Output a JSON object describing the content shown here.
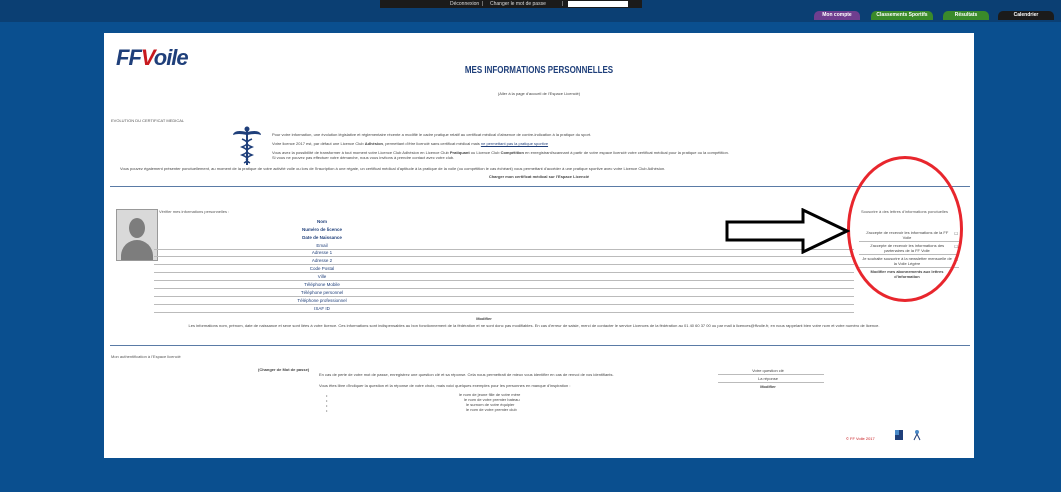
{
  "top_bar": {
    "links": [
      "Déconnexion",
      "|",
      "Changer le mot de passe",
      "|"
    ]
  },
  "tabs": [
    {
      "label": "Mon compte",
      "color": "#6f3e8f"
    },
    {
      "label": "Classements Sportifs",
      "color": "#3a8a2a"
    },
    {
      "label": "Résultats",
      "color": "#3a8a2a"
    },
    {
      "label": "Calendrier",
      "color": "#1b1b1b"
    }
  ],
  "logo": {
    "ff": "FF",
    "v": "V",
    "rest": "oile"
  },
  "page_title": "MES INFORMATIONS PERSONNELLES",
  "home_link": "(Aller à la page d'accueil de l'Espace Licencié)",
  "medical": {
    "heading": "EVOLUTION DU CERTIFICAT MEDICAL",
    "p1": "Pour votre information, une évolution législative et réglementaire récente a modifié le cadre pratique relatif au certificat médical d'absence de contre-indication à la pratique du sport.",
    "p2_a": "Votre licence 2017 est, par défaut une Licence Club ",
    "p2_b": "Adhésion",
    "p2_c": ", permettant d'être licencié sans certificat médical mais ",
    "p2_d": "ne permettant pas la pratique sportive",
    "p3_a": "Vous avez la possibilité de transformer à tout moment votre Licence Club Adhésion en Licence Club ",
    "p3_b": "Pratiquant",
    "p3_c": " ou Licence Club ",
    "p3_d": "Compétition",
    "p3_e": " en enregistrant/scannant à partir de votre espace licencié votre certificat médical pour la pratique ou la compétition.",
    "p3_f": "Si vous ne pouvez pas effectuer votre démarche, nous vous invitons à prendre contact avec votre club.",
    "p4": "Vous pouvez également présenter ponctuellement, au moment de la pratique de votre activité voile ou lors de l'inscription à une régate, un certificat médical d'aptitude à la pratique de la voile (ou compétition le cas échéant) vous permettant d'accéder à une pratique sportive avec votre Licence Club Adhésion.",
    "upload_link": "Charger mon certificat médical sur l'Espace Licencié"
  },
  "personal": {
    "verify_label": "Vérifier mes informations personnelles :",
    "fields": [
      "Nom",
      "Numéro de licence",
      "Date de Naissance",
      "Email",
      "Adresse 1",
      "Adresse 2",
      "Code Postal",
      "Ville",
      "Téléphone Mobile",
      "Téléphone personnel",
      "Téléphone professionnel",
      "ISAF ID"
    ],
    "modify": "Modifier",
    "notice": "Les informations nom, prénom, date de naissance et sexe sont liées à votre licence. Ces informations sont indispensables au bon fonctionnement de la fédération et ne sont donc pas modifiables. En cas d'erreur de saisie, merci de contacter le service Licences de la fédération au 01 40 60 37 00 ou par mail à licences@ffvoile.fr, en nous rappelant bien votre nom et votre numéro de licence."
  },
  "newsletters": {
    "heading": "Souscrire à des lettres d'informations ponctuelles",
    "options": [
      "J'accepte de recevoir les informations de la FF Voile",
      "J'accepte de recevoir les informations des partenaires de la FF Voile",
      "Je souhaite souscrire à la newsletter mensuelle de la Voile Légère"
    ],
    "modify": "Modifier mes abonnements aux lettres d'information"
  },
  "auth": {
    "heading": "Mon authentification à l'Espace licencié",
    "change_pwd": "(Changer de Mot de passe)",
    "p1": "En cas de perte de votre mot de passe, enregistrez une question clé et sa réponse. Cela nous permettrait de mieux vous identifier en cas de renvoi de vos identifiants.",
    "p2": "Vous êtes libre d'indiquer la question et la réponse de votre choix, mais voici quelques exemples pour les personnes en manque d'inspiration :",
    "examples": [
      "le nom de jeune fille de votre mère",
      "le nom de votre premier bateau",
      "le surnom de votre équipier",
      "le nom de votre premier club"
    ],
    "question_label": "Votre question clé",
    "answer_label": "La réponse",
    "modify": "Modifier"
  },
  "footer": {
    "copyright": "© FF Voile 2017"
  }
}
